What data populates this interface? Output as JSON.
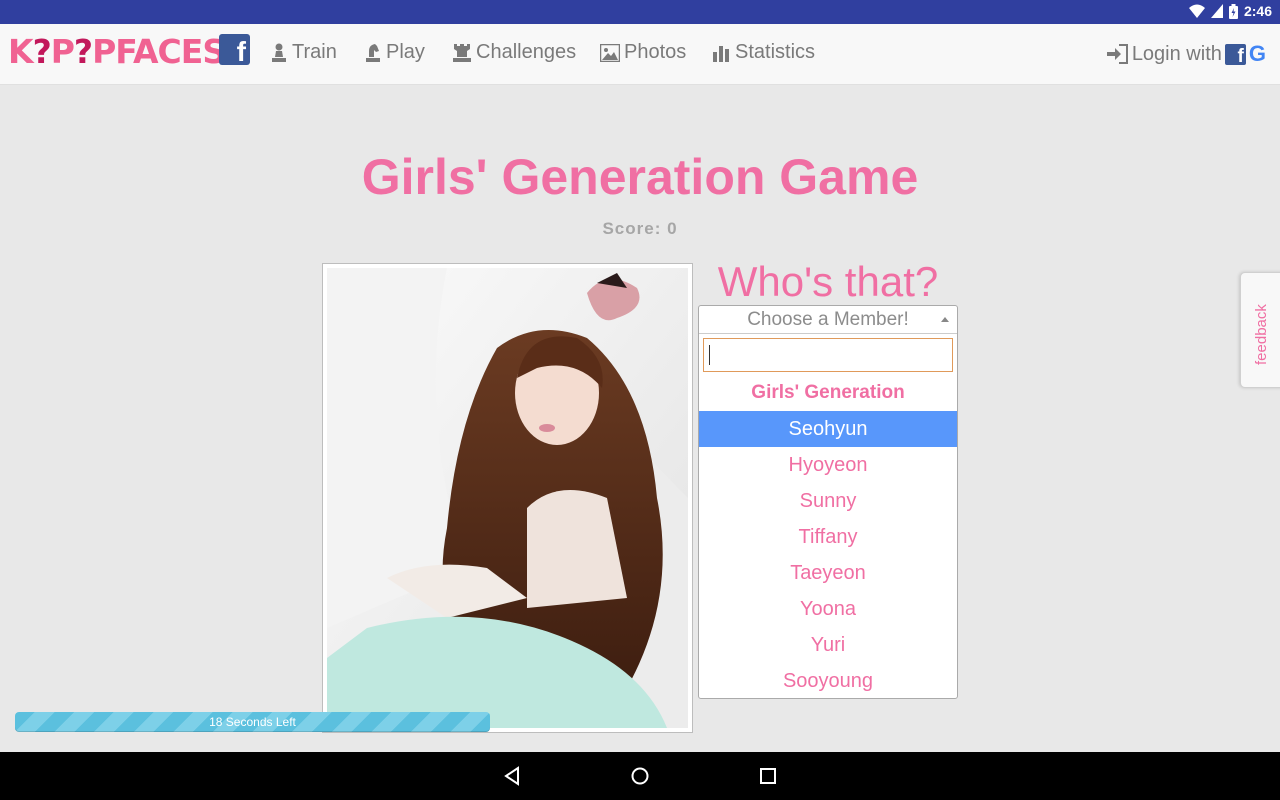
{
  "statusbar": {
    "time": "2:46"
  },
  "nav": {
    "logo": {
      "part1": "K",
      "part2": "P",
      "part3": "PFACES"
    },
    "fb_letter": "f",
    "items": [
      {
        "label": "Train",
        "icon": "pawn-icon"
      },
      {
        "label": "Play",
        "icon": "knight-icon"
      },
      {
        "label": "Challenges",
        "icon": "rook-icon"
      },
      {
        "label": "Photos",
        "icon": "photo-icon"
      },
      {
        "label": "Statistics",
        "icon": "bar-chart-icon"
      }
    ],
    "login_label": "Login with",
    "google_letter": "G"
  },
  "game": {
    "title": "Girls' Generation Game",
    "score": "Score: 0",
    "question": "Who's that?"
  },
  "select": {
    "placeholder": "Choose a Member!",
    "search_value": "",
    "group": "Girls' Generation",
    "options": [
      "Seohyun",
      "Hyoyeon",
      "Sunny",
      "Tiffany",
      "Taeyeon",
      "Yoona",
      "Yuri",
      "Sooyoung"
    ],
    "highlighted": "Seohyun"
  },
  "feedback_label": "feedback",
  "timer": {
    "label": "18 Seconds Left"
  },
  "colors": {
    "accent": "#f06fa3",
    "highlight": "#5897fb",
    "status_bar": "#303f9f",
    "timer": "#5bc0de"
  }
}
